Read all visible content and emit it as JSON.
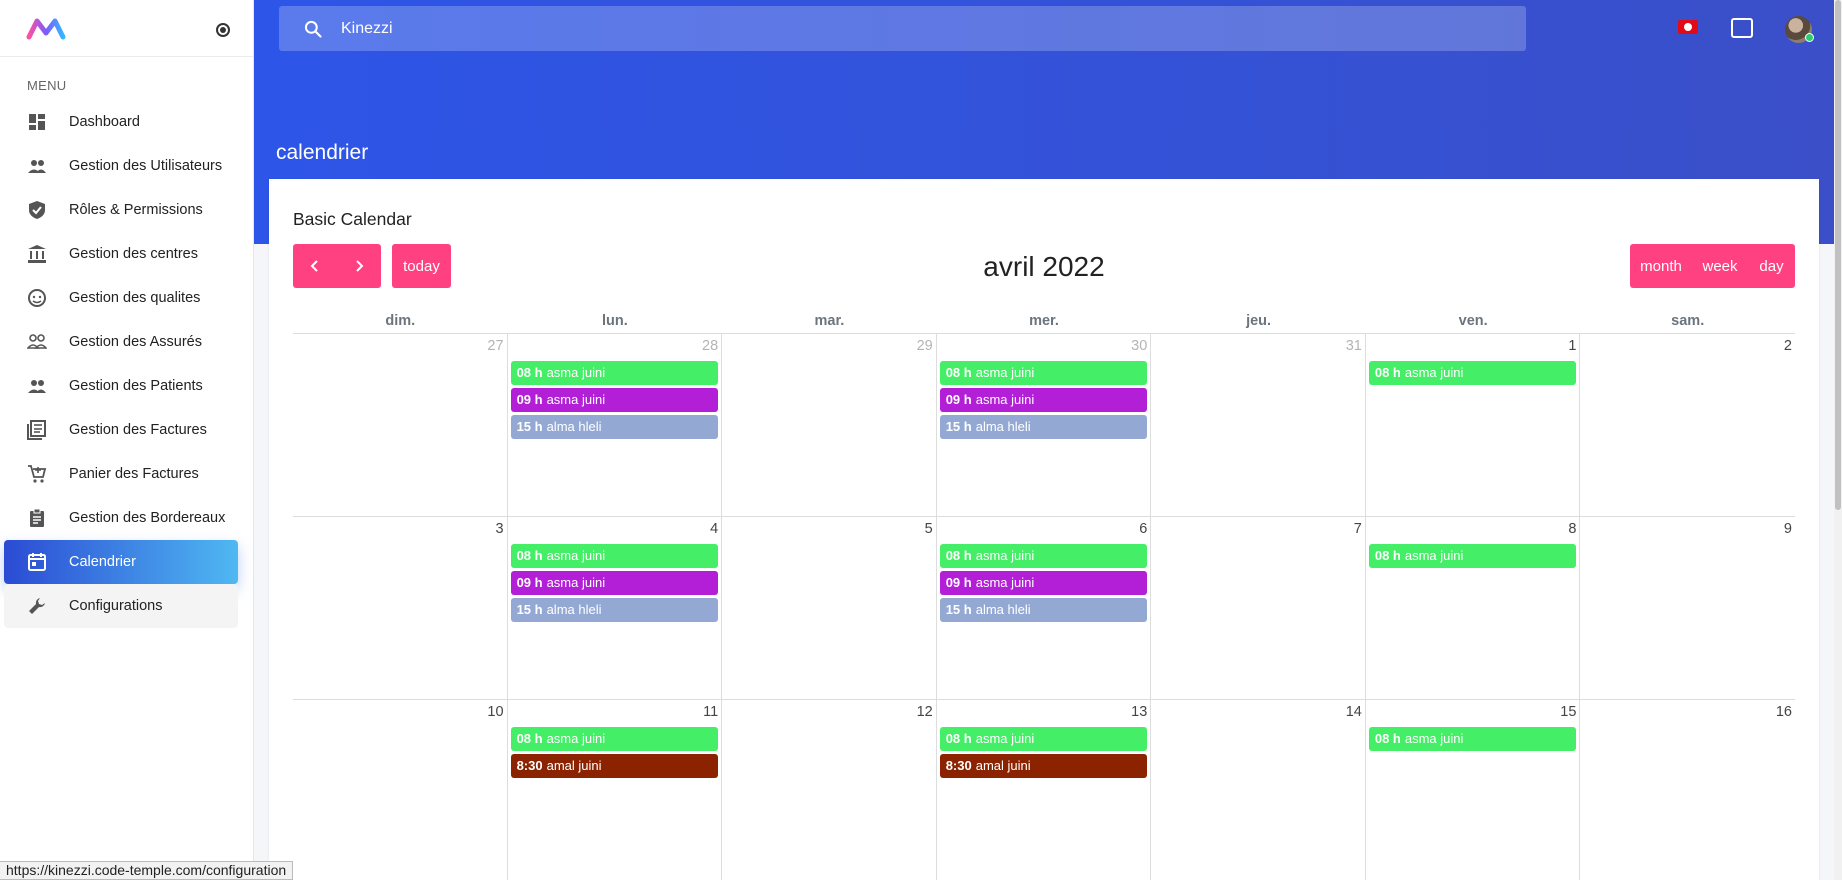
{
  "sidebar": {
    "menu_title": "MENU",
    "items": [
      {
        "label": "Dashboard",
        "icon": "dashboard-icon"
      },
      {
        "label": "Gestion des Utilisateurs",
        "icon": "users-icon"
      },
      {
        "label": "Rôles & Permissions",
        "icon": "shield-check-icon"
      },
      {
        "label": "Gestion des centres",
        "icon": "bank-icon"
      },
      {
        "label": "Gestion des qualites",
        "icon": "face-icon"
      },
      {
        "label": "Gestion des Assurés",
        "icon": "people-outline-icon"
      },
      {
        "label": "Gestion des Patients",
        "icon": "patients-icon"
      },
      {
        "label": "Gestion des Factures",
        "icon": "invoice-list-icon"
      },
      {
        "label": "Panier des Factures",
        "icon": "cart-icon"
      },
      {
        "label": "Gestion des Bordereaux",
        "icon": "clipboard-icon"
      },
      {
        "label": "Calendrier",
        "icon": "calendar-icon"
      },
      {
        "label": "Configurations",
        "icon": "wrench-icon"
      }
    ],
    "active_index": 10,
    "hover_index": 11
  },
  "search": {
    "value": "Kinezzi"
  },
  "page_title": "calendrier",
  "card": {
    "title": "Basic Calendar",
    "today_label": "today",
    "view_buttons": {
      "month": "month",
      "week": "week",
      "day": "day"
    }
  },
  "calendar": {
    "title": "avril 2022",
    "weekdays": [
      "dim.",
      "lun.",
      "mar.",
      "mer.",
      "jeu.",
      "ven.",
      "sam."
    ],
    "weeks": [
      [
        {
          "num": "27",
          "other": true,
          "events": []
        },
        {
          "num": "28",
          "other": true,
          "events": [
            {
              "time": "08 h",
              "title": "asma juini",
              "color": "#44ee66"
            },
            {
              "time": "09 h",
              "title": "asma juini",
              "color": "#b21fd6"
            },
            {
              "time": "15 h",
              "title": "alma hleli",
              "color": "#93a9d4"
            }
          ]
        },
        {
          "num": "29",
          "other": true,
          "events": []
        },
        {
          "num": "30",
          "other": true,
          "events": [
            {
              "time": "08 h",
              "title": "asma juini",
              "color": "#44ee66"
            },
            {
              "time": "09 h",
              "title": "asma juini",
              "color": "#b21fd6"
            },
            {
              "time": "15 h",
              "title": "alma hleli",
              "color": "#93a9d4"
            }
          ]
        },
        {
          "num": "31",
          "other": true,
          "events": []
        },
        {
          "num": "1",
          "other": false,
          "events": [
            {
              "time": "08 h",
              "title": "asma juini",
              "color": "#44ee66"
            }
          ]
        },
        {
          "num": "2",
          "other": false,
          "events": []
        }
      ],
      [
        {
          "num": "3",
          "other": false,
          "events": []
        },
        {
          "num": "4",
          "other": false,
          "events": [
            {
              "time": "08 h",
              "title": "asma juini",
              "color": "#44ee66"
            },
            {
              "time": "09 h",
              "title": "asma juini",
              "color": "#b21fd6"
            },
            {
              "time": "15 h",
              "title": "alma hleli",
              "color": "#93a9d4"
            }
          ]
        },
        {
          "num": "5",
          "other": false,
          "events": []
        },
        {
          "num": "6",
          "other": false,
          "events": [
            {
              "time": "08 h",
              "title": "asma juini",
              "color": "#44ee66"
            },
            {
              "time": "09 h",
              "title": "asma juini",
              "color": "#b21fd6"
            },
            {
              "time": "15 h",
              "title": "alma hleli",
              "color": "#93a9d4"
            }
          ]
        },
        {
          "num": "7",
          "other": false,
          "events": []
        },
        {
          "num": "8",
          "other": false,
          "events": [
            {
              "time": "08 h",
              "title": "asma juini",
              "color": "#44ee66"
            }
          ]
        },
        {
          "num": "9",
          "other": false,
          "events": []
        }
      ],
      [
        {
          "num": "10",
          "other": false,
          "events": []
        },
        {
          "num": "11",
          "other": false,
          "events": [
            {
              "time": "08 h",
              "title": "asma juini",
              "color": "#44ee66"
            },
            {
              "time": "8:30",
              "title": "amal juini",
              "color": "#8b2300"
            }
          ]
        },
        {
          "num": "12",
          "other": false,
          "events": []
        },
        {
          "num": "13",
          "other": false,
          "events": [
            {
              "time": "08 h",
              "title": "asma juini",
              "color": "#44ee66"
            },
            {
              "time": "8:30",
              "title": "amal juini",
              "color": "#8b2300"
            }
          ]
        },
        {
          "num": "14",
          "other": false,
          "events": []
        },
        {
          "num": "15",
          "other": false,
          "events": [
            {
              "time": "08 h",
              "title": "asma juini",
              "color": "#44ee66"
            }
          ]
        },
        {
          "num": "16",
          "other": false,
          "events": []
        }
      ]
    ]
  },
  "status_url": "https://kinezzi.code-temple.com/configuration",
  "colors": {
    "accent": "#ff4081",
    "banner": "#2d55e8"
  }
}
